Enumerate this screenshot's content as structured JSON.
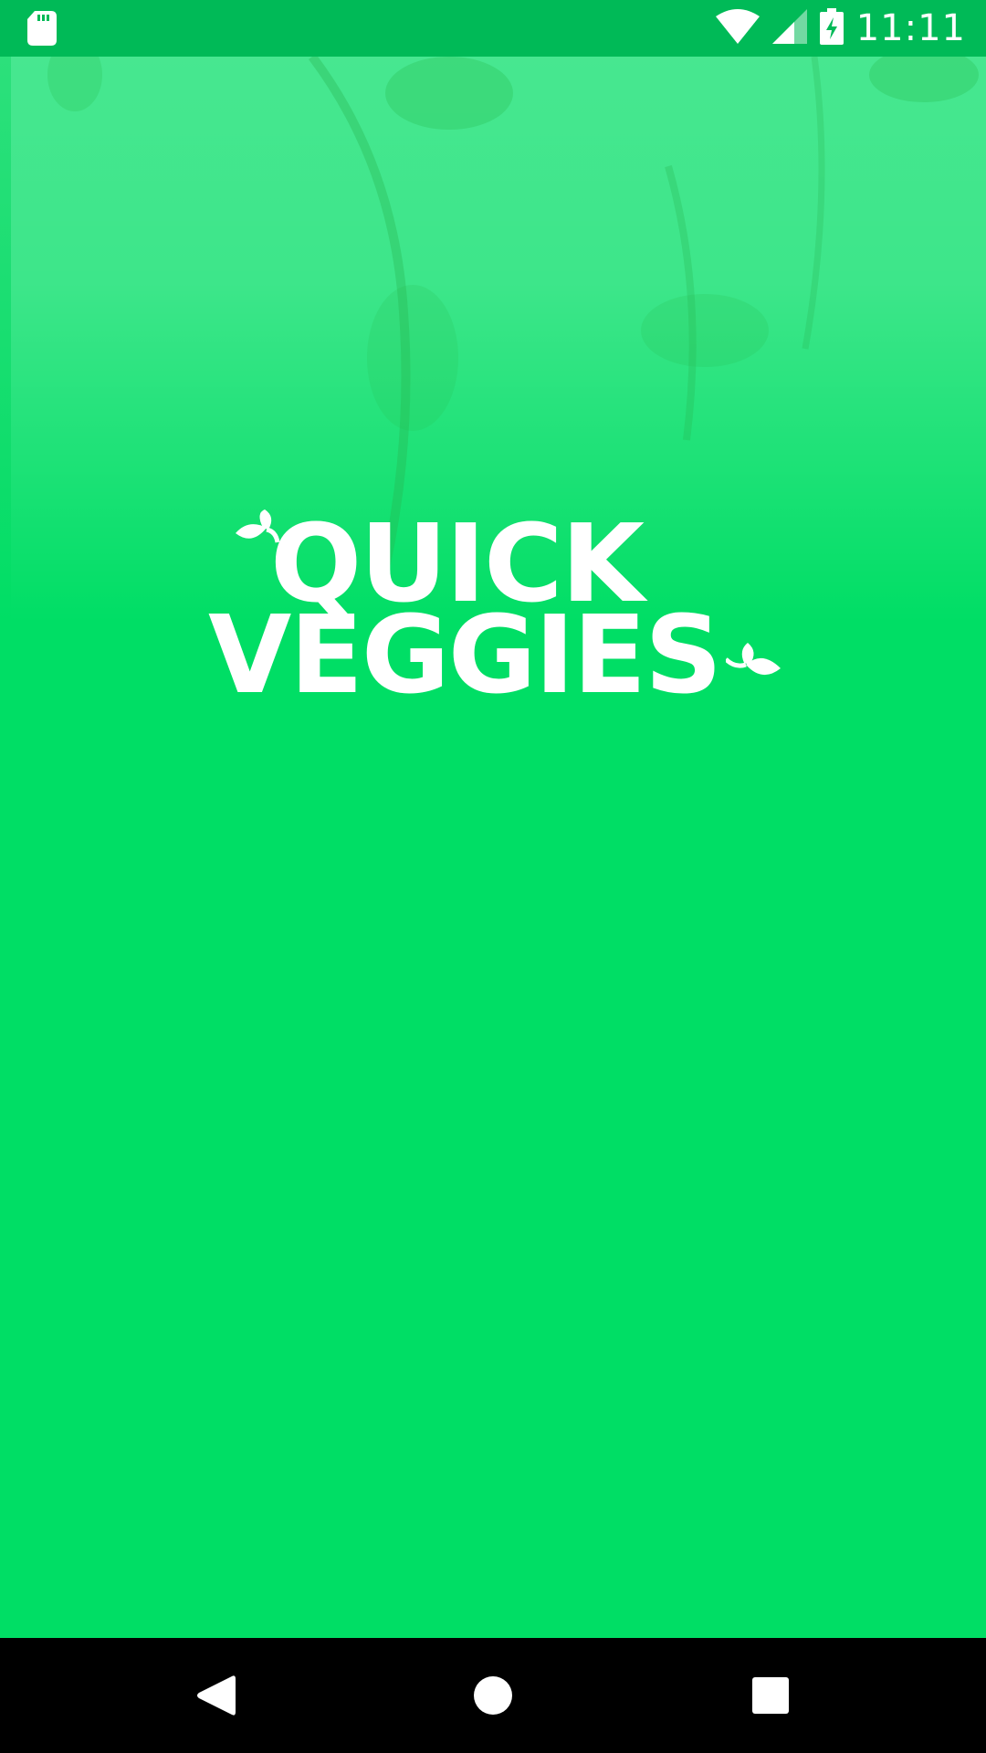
{
  "status_bar": {
    "time": "11:11",
    "icons": [
      "sd-card-icon",
      "wifi-icon",
      "cellular-signal-icon",
      "battery-charging-icon"
    ],
    "background_color": "#00BA57"
  },
  "splash": {
    "background_color": "#00DE65",
    "logo": {
      "line1": "QUICK",
      "line2": "VEGGIES",
      "color": "#FFFFFF"
    }
  },
  "nav_bar": {
    "background_color": "#000000",
    "buttons": [
      "back-icon",
      "home-icon",
      "recents-icon"
    ]
  }
}
